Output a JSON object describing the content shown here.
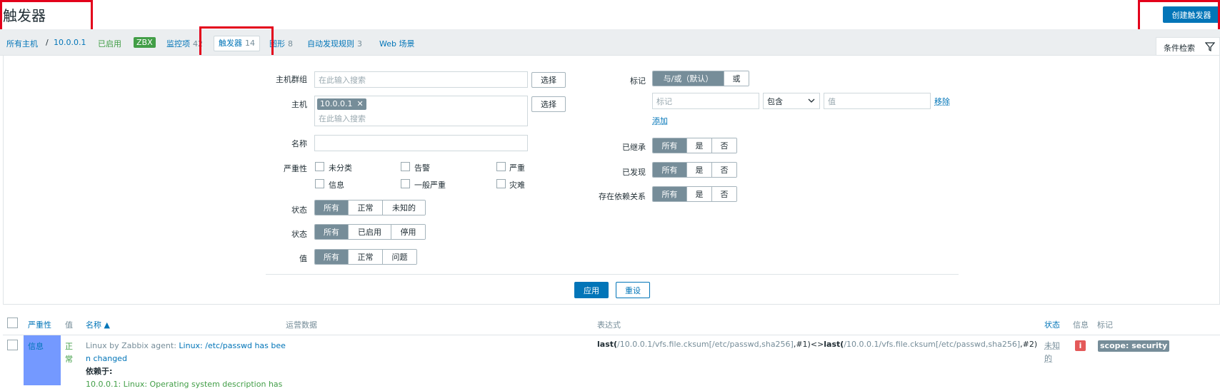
{
  "page": {
    "title": "触发器",
    "create_button": "创建触发器"
  },
  "nav": {
    "all_hosts": "所有主机",
    "separator": "/",
    "host": "10.0.0.1",
    "enabled": "已启用",
    "zbx": "ZBX",
    "items": {
      "label": "监控项",
      "count": "42"
    },
    "triggers": {
      "label": "触发器",
      "count": "14"
    },
    "graphs": {
      "label": "图形",
      "count": "8"
    },
    "discovery": {
      "label": "自动发现规则",
      "count": "3"
    },
    "web": {
      "label": "Web 场景"
    }
  },
  "filter_tab": {
    "label": "条件检索"
  },
  "filter": {
    "host_group": {
      "label": "主机群组",
      "placeholder": "在此输入搜索",
      "button": "选择"
    },
    "host": {
      "label": "主机",
      "chip": "10.0.0.1",
      "placeholder": "在此输入搜索",
      "button": "选择"
    },
    "name": {
      "label": "名称",
      "value": ""
    },
    "severity": {
      "label": "严重性",
      "options": [
        "未分类",
        "告警",
        "严重",
        "信息",
        "一般严重",
        "灾难"
      ]
    },
    "state": {
      "label": "状态",
      "options": [
        "所有",
        "正常",
        "未知的"
      ],
      "selected": "所有"
    },
    "status": {
      "label": "状态",
      "options": [
        "所有",
        "已启用",
        "停用"
      ],
      "selected": "所有"
    },
    "value": {
      "label": "值",
      "options": [
        "所有",
        "正常",
        "问题"
      ],
      "selected": "所有"
    },
    "tags": {
      "label": "标记",
      "mode_options": [
        "与/或（默认）",
        "或"
      ],
      "mode_selected": "与/或（默认）",
      "tag_placeholder": "标记",
      "operator": "包含",
      "value_placeholder": "值",
      "remove": "移除",
      "add": "添加"
    },
    "inherited": {
      "label": "已继承",
      "options": [
        "所有",
        "是",
        "否"
      ],
      "selected": "所有"
    },
    "discovered": {
      "label": "已发现",
      "options": [
        "所有",
        "是",
        "否"
      ],
      "selected": "所有"
    },
    "dependencies": {
      "label": "存在依赖关系",
      "options": [
        "所有",
        "是",
        "否"
      ],
      "selected": "所有"
    },
    "apply": "应用",
    "reset": "重设"
  },
  "table": {
    "headers": {
      "severity": "严重性",
      "value": "值",
      "name": "名称 ▲",
      "operational_data": "运营数据",
      "expression": "表达式",
      "status": "状态",
      "info": "信息",
      "tags": "标记"
    },
    "rows": [
      {
        "severity": "信息",
        "value": "正常",
        "name_template": "Linux by Zabbix agent",
        "name_sep": ":",
        "name_line1": "Linux: /etc/passwd has bee",
        "name_line2": "n changed",
        "depends_label": "依赖于:",
        "depends_item": "10.0.0.1: Linux: Operating system description has",
        "expr_fn1": "last(",
        "expr_arg1": "/10.0.0.1/vfs.file.cksum[/etc/passwd,sha256]",
        "expr_mid": ",#1)<>",
        "expr_fn2": "last(",
        "expr_arg2": "/10.0.0.1/vfs.file.cksum[/etc/passwd,sha256]",
        "expr_end": ",#2)",
        "status_line1": "未知",
        "status_line2": "的",
        "info_icon": "i",
        "tag": "scope: security"
      }
    ]
  },
  "colors": {
    "accent": "#0275b8",
    "green": "#429e47",
    "info_severity": "#7499ff",
    "info_icon": "#e45959",
    "segment_on": "#768d99",
    "red_box": "#e3001b"
  }
}
